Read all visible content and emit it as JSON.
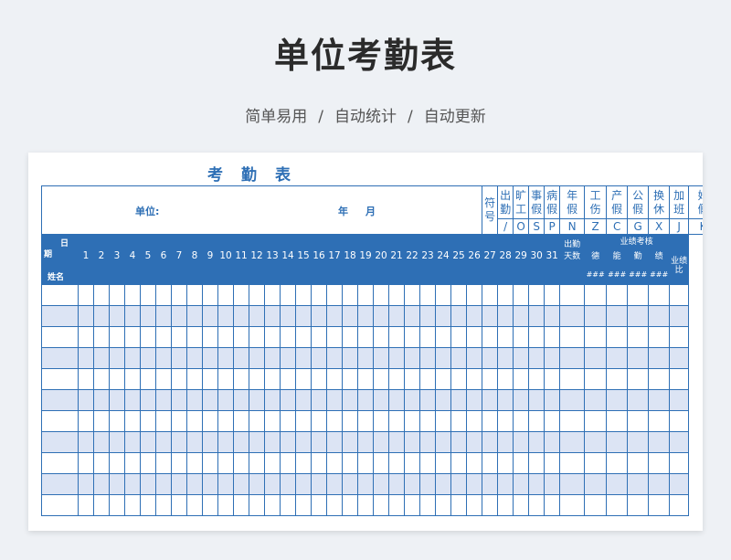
{
  "page": {
    "title": "单位考勤表",
    "subtitle": [
      "简单易用",
      "自动统计",
      "自动更新"
    ],
    "subtitle_separator": "/"
  },
  "sheet": {
    "title_chars": [
      "考",
      "勤",
      "表"
    ],
    "unit_label": "单位:",
    "year_label": "年",
    "month_label": "月",
    "legend": [
      {
        "name": "符号",
        "symbol": ""
      },
      {
        "name": "出勤",
        "symbol": "/"
      },
      {
        "name": "旷工",
        "symbol": "O"
      },
      {
        "name": "事假",
        "symbol": "S"
      },
      {
        "name": "病假",
        "symbol": "P"
      },
      {
        "name": "年假",
        "symbol": "N"
      },
      {
        "name": "工伤",
        "symbol": "Z"
      },
      {
        "name": "产假",
        "symbol": "C"
      },
      {
        "name": "公假",
        "symbol": "G"
      },
      {
        "name": "换休",
        "symbol": "X"
      },
      {
        "name": "加班",
        "symbol": "J"
      },
      {
        "name": "婚假",
        "symbol": "K"
      }
    ],
    "corner": {
      "day": "日",
      "period": "期",
      "name": "姓名"
    },
    "days": [
      "1",
      "2",
      "3",
      "4",
      "5",
      "6",
      "7",
      "8",
      "9",
      "10",
      "11",
      "12",
      "13",
      "14",
      "15",
      "16",
      "17",
      "18",
      "19",
      "20",
      "21",
      "22",
      "23",
      "24",
      "25",
      "26",
      "27",
      "28",
      "29",
      "30",
      "31"
    ],
    "attendance_days_label": "出勤天数",
    "performance_group_label": "业绩考核",
    "performance_cols": [
      "德",
      "能",
      "勤",
      "绩"
    ],
    "performance_ratio_label": "业绩比",
    "performance_placeholder": "###",
    "data_rows": 11
  },
  "colors": {
    "accent": "#2e6fb5",
    "row_alt": "#dce4f4",
    "background": "#eef1f5"
  }
}
